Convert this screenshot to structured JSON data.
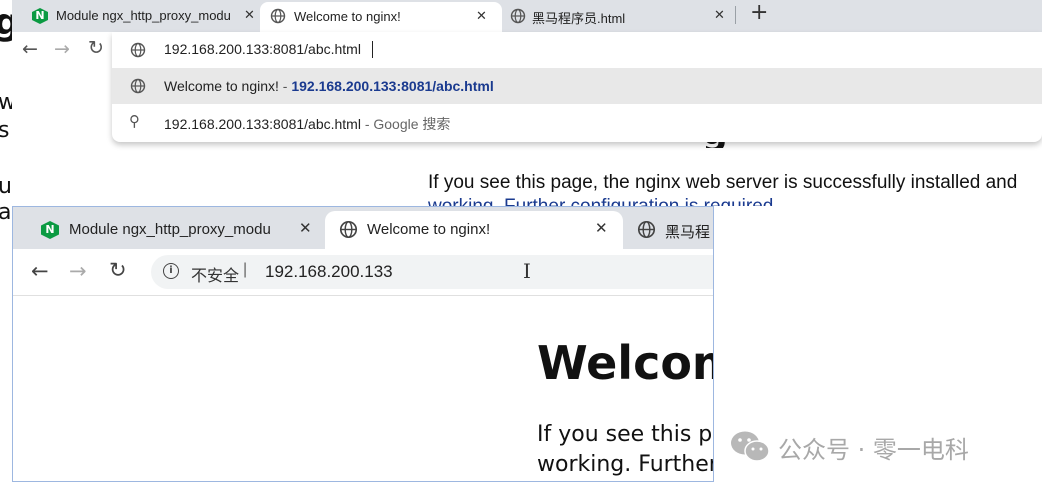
{
  "back_window": {
    "tabs": [
      {
        "title": "Module ngx_http_proxy_modu",
        "icon": "nginx-icon",
        "close": "✕"
      },
      {
        "title": "Welcome to nginx!",
        "icon": "globe-icon",
        "close": "✕"
      },
      {
        "title": "黑马程序员.html",
        "icon": "globe-icon",
        "close": "✕"
      }
    ],
    "new_tab": "+",
    "address_value": "192.168.200.133:8081/abc.html",
    "suggestions": [
      {
        "title": "Welcome to nginx!",
        "sep": " - ",
        "url": "192.168.200.133:8081/abc.html"
      },
      {
        "query": "192.168.200.133:8081/abc.html",
        "suffix": " - Google 搜索"
      }
    ],
    "page_text_line1": "If you see this page, the nginx web server is successfully installed and",
    "page_text_line2": "working. Further configuration is required.",
    "left_fragments": [
      "g",
      "w",
      "s",
      "u",
      "a"
    ]
  },
  "front_window": {
    "tabs": [
      {
        "title": "Module ngx_http_proxy_modu",
        "icon": "nginx-icon",
        "close": "✕"
      },
      {
        "title": "Welcome to nginx!",
        "icon": "globe-icon",
        "close": "✕"
      },
      {
        "title": "黑马程",
        "icon": "globe-icon"
      }
    ],
    "security_label": "不安全",
    "address_sep": "|",
    "address_value": "192.168.200.133",
    "heading": "Welcome to nginx!",
    "body_line1": "If you see this page, the nginx web server is successfully installed and",
    "body_line2": "working. Further configuration is required."
  },
  "watermark": {
    "text": "公众号 · 零一电科",
    "icon": "wechat-icon"
  },
  "colors": {
    "tab_strip": "#dee1e6",
    "active_tab": "#ffffff",
    "suggestion_highlight": "#e8e8e8",
    "url_blue": "#1a3a8f",
    "front_border": "#9db7e0"
  }
}
